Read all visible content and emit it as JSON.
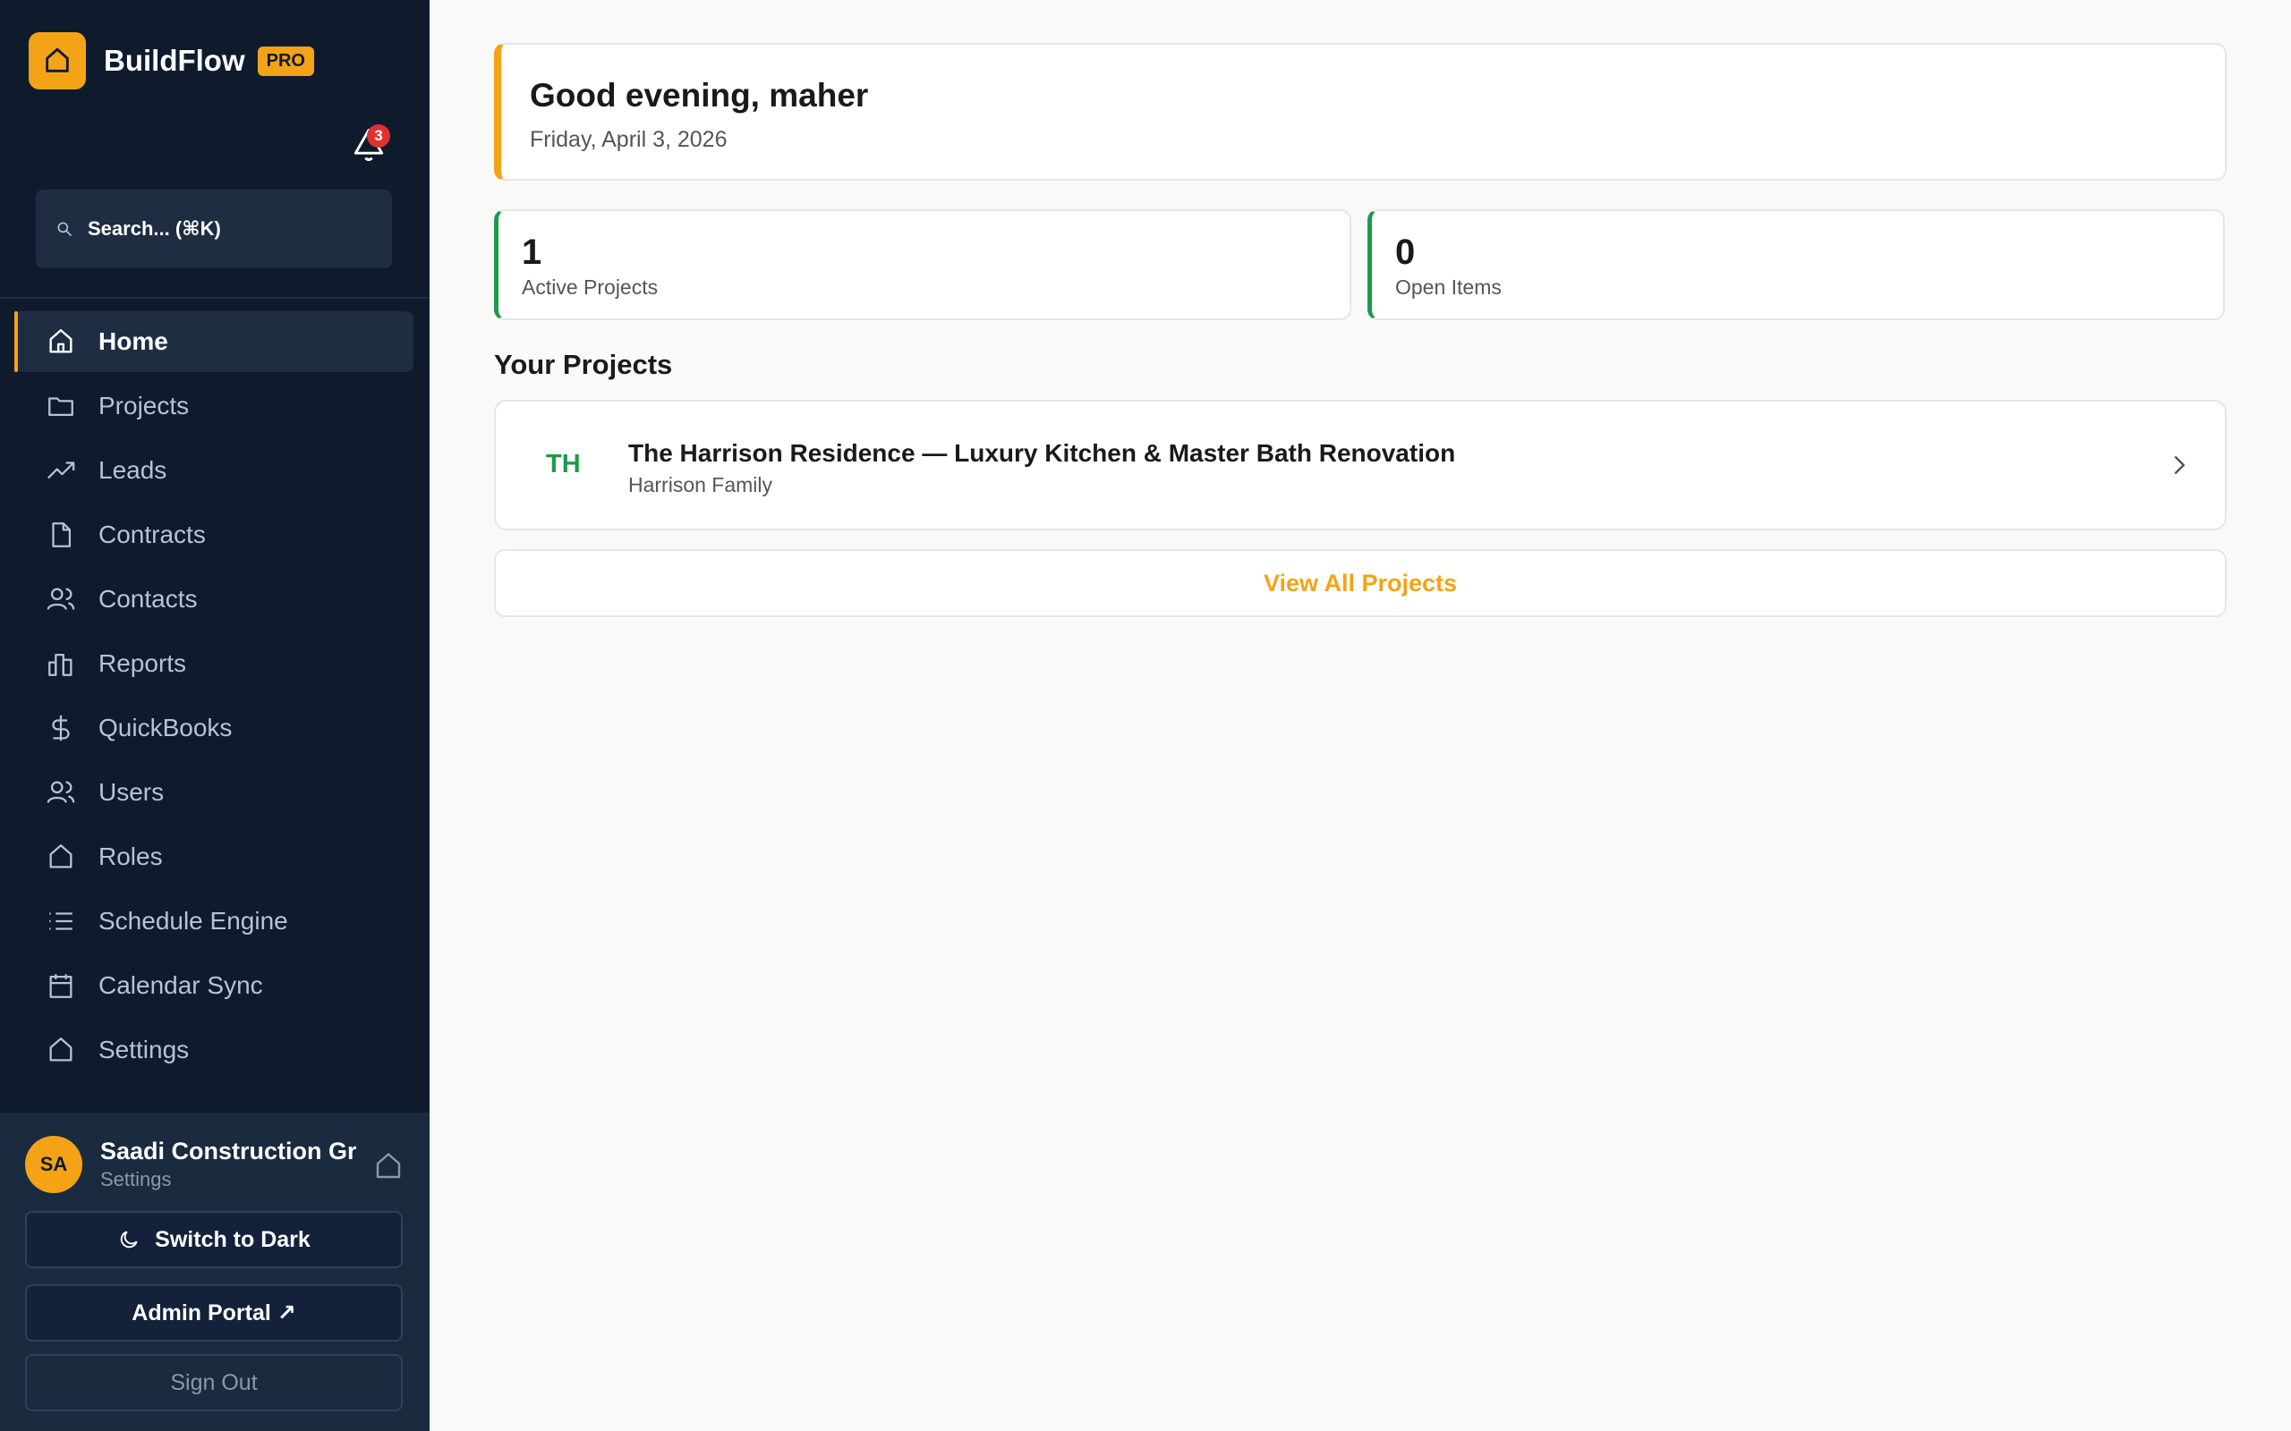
{
  "brand": {
    "name": "BuildFlow",
    "badge": "PRO",
    "accent": "#f5a316"
  },
  "notifications": {
    "count": "3"
  },
  "search": {
    "placeholder": "Search... (⌘K)"
  },
  "nav": {
    "items": [
      {
        "label": "Home",
        "icon": "home-icon",
        "active": true
      },
      {
        "label": "Projects",
        "icon": "folder-icon"
      },
      {
        "label": "Leads",
        "icon": "trending-up-icon"
      },
      {
        "label": "Contracts",
        "icon": "document-icon"
      },
      {
        "label": "Contacts",
        "icon": "users-icon"
      },
      {
        "label": "Reports",
        "icon": "bar-chart-icon"
      },
      {
        "label": "QuickBooks",
        "icon": "dollar-icon"
      },
      {
        "label": "Users",
        "icon": "users-icon"
      },
      {
        "label": "Roles",
        "icon": "home-icon"
      },
      {
        "label": "Schedule Engine",
        "icon": "list-icon"
      },
      {
        "label": "Calendar Sync",
        "icon": "calendar-icon"
      },
      {
        "label": "Settings",
        "icon": "home-icon"
      }
    ]
  },
  "account": {
    "initials": "SA",
    "org_name": "Saadi Construction Group",
    "sub": "Settings",
    "switch_theme": "Switch to Dark",
    "admin_portal": "Admin Portal ↗",
    "sign_out": "Sign Out"
  },
  "greeting": {
    "title": "Good evening, maher",
    "date": "Friday, April 3, 2026"
  },
  "stats": [
    {
      "value": "1",
      "label": "Active Projects"
    },
    {
      "value": "0",
      "label": "Open Items"
    }
  ],
  "projects_section": {
    "title": "Your Projects",
    "view_all": "View All Projects"
  },
  "projects": [
    {
      "initials": "TH",
      "title": "The Harrison Residence — Luxury Kitchen & Master Bath Renovation",
      "client": "Harrison Family"
    }
  ],
  "colors": {
    "sidebar": "#0f1b2d",
    "success": "#1a9c4a",
    "danger": "#e03030"
  }
}
